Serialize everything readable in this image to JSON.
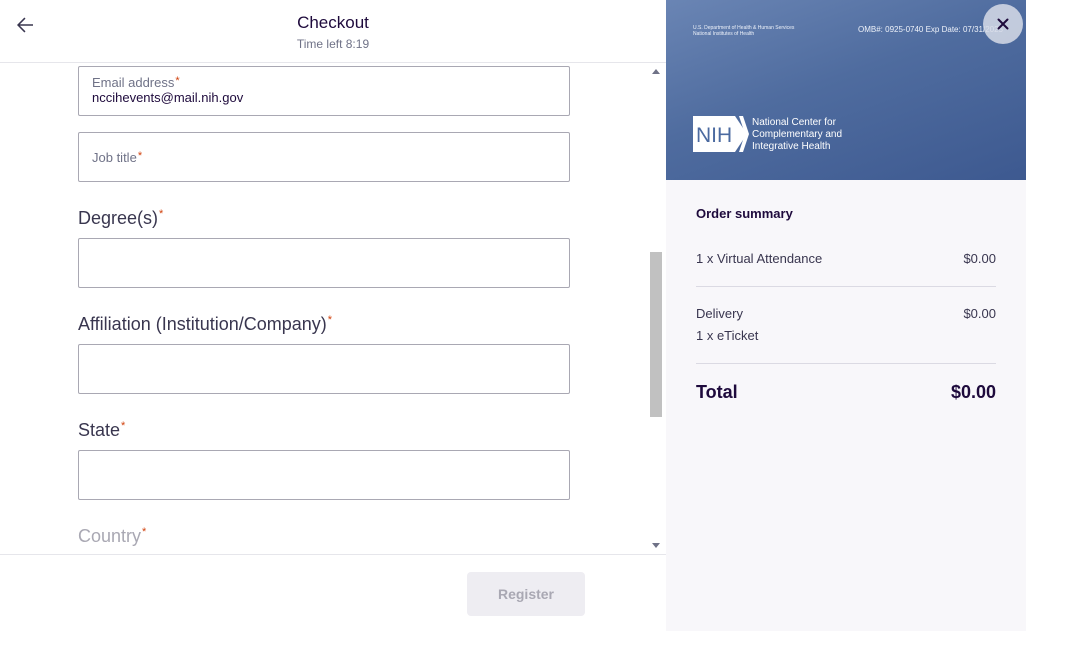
{
  "header": {
    "title": "Checkout",
    "timer": "Time left 8:19"
  },
  "form": {
    "email": {
      "label": "Email address",
      "value": "nccihevents@mail.nih.gov"
    },
    "job_title": {
      "label": "Job title",
      "value": ""
    },
    "degrees": {
      "label": "Degree(s)",
      "value": ""
    },
    "affiliation": {
      "label": "Affiliation (Institution/Company)",
      "value": ""
    },
    "state": {
      "label": "State",
      "value": ""
    },
    "country": {
      "label": "Country"
    },
    "required_mark": "*"
  },
  "footer": {
    "register_label": "Register"
  },
  "banner": {
    "dept_line1": "U.S. Department of Health & Human Services",
    "dept_line2": "National Institutes of Health",
    "omb": "OMB#: 0925-0740 Exp Date: 07/31/2025",
    "logo_text": "NIH",
    "center_line1": "National Center for",
    "center_line2": "Complementary and",
    "center_line3": "Integrative Health",
    "close_icon": "close-icon"
  },
  "summary": {
    "title": "Order summary",
    "items": [
      {
        "label": "1 x Virtual Attendance",
        "price": "$0.00"
      }
    ],
    "delivery": {
      "label": "Delivery",
      "price": "$0.00",
      "detail": "1 x eTicket"
    },
    "total": {
      "label": "Total",
      "price": "$0.00"
    }
  },
  "colors": {
    "accent_required": "#d1410c",
    "banner_blue": "#4f6c9f",
    "register_disabled_bg": "#eeedf2"
  }
}
